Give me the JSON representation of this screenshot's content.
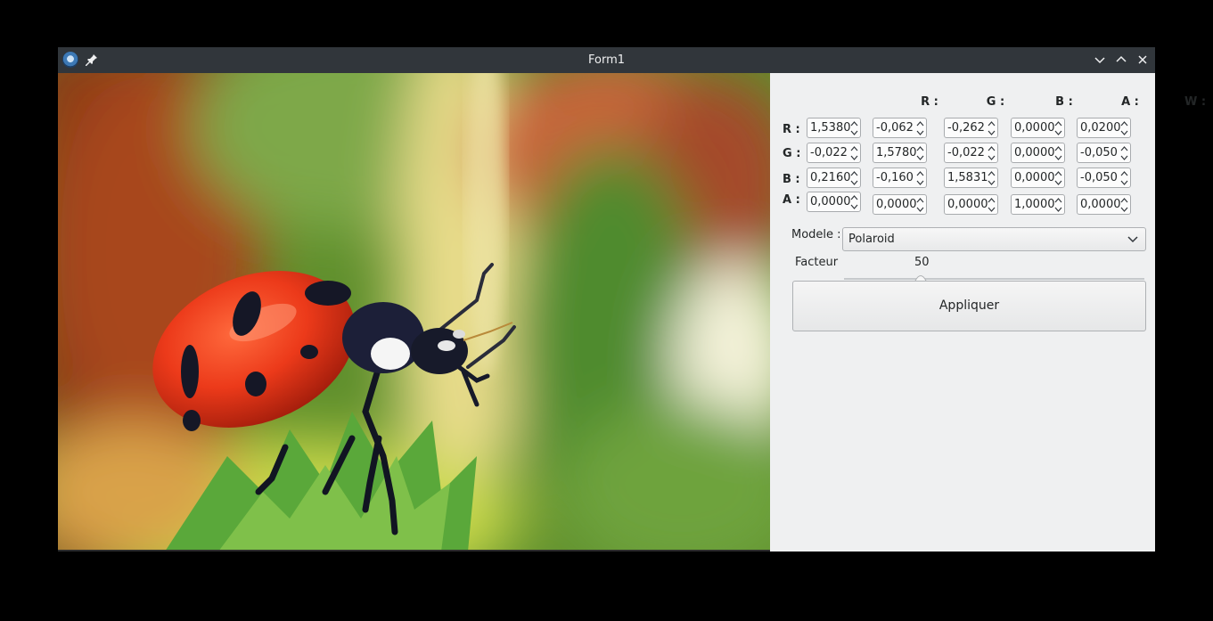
{
  "window": {
    "title": "Form1",
    "icons": [
      "app-paw-icon",
      "pin-icon",
      "minimize-icon",
      "maximize-icon",
      "close-icon"
    ]
  },
  "matrix": {
    "col_labels": [
      "R :",
      "G :",
      "B :",
      "A :",
      "W :"
    ],
    "row_labels": [
      "R :",
      "G :",
      "B :",
      "A :"
    ],
    "rows": [
      [
        "1,5380",
        "-0,062",
        "-0,262",
        "0,0000",
        "0,0200"
      ],
      [
        "-0,022",
        "1,5780",
        "-0,022",
        "0,0000",
        "-0,050"
      ],
      [
        "0,2160",
        "-0,160",
        "1,5831",
        "0,0000",
        "-0,050"
      ],
      [
        "0,0000",
        "0,0000",
        "0,0000",
        "1,0000",
        "0,0000"
      ]
    ]
  },
  "modele": {
    "label": "Modele :",
    "value": "Polaroid"
  },
  "facteur": {
    "label": "Facteur",
    "value": "50"
  },
  "apply_label": "Appliquer",
  "colors": {
    "titlebar": "#31363b",
    "panel": "#eff0f1",
    "ladybug": "#e8321a"
  }
}
